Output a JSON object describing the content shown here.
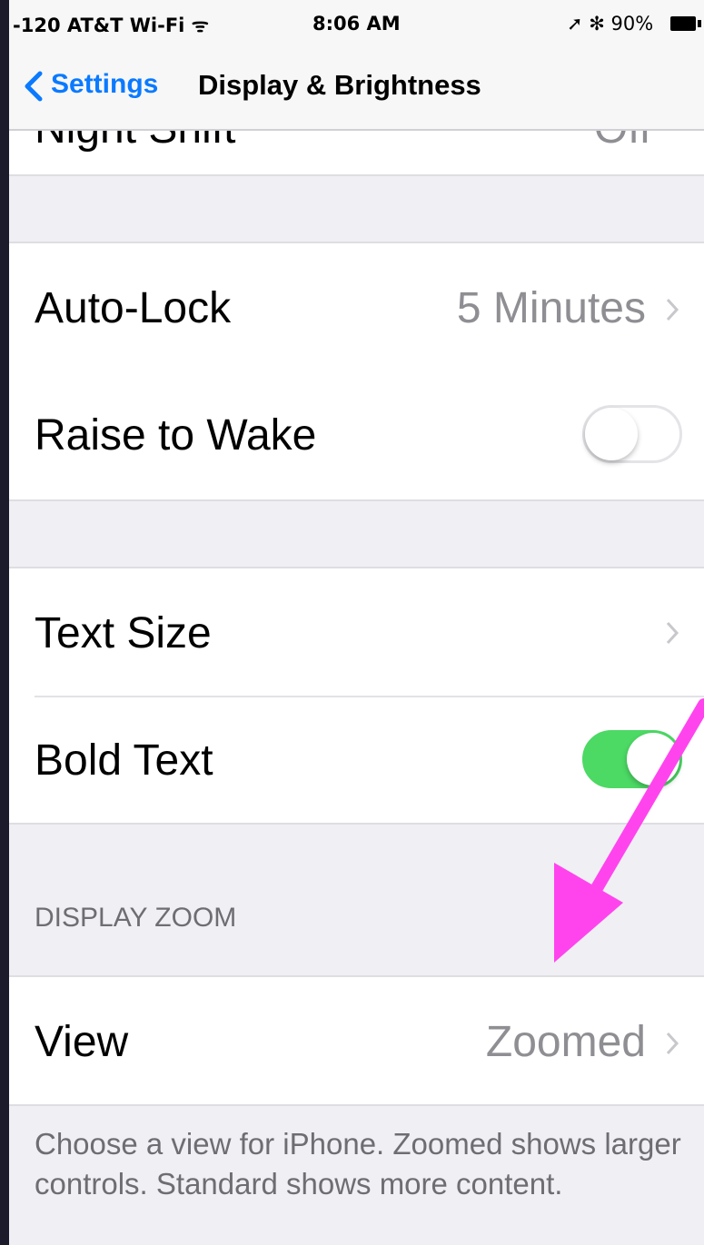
{
  "status_bar": {
    "carrier": "-120 AT&T Wi-Fi ᯤ",
    "time": "8:06 AM",
    "right": "➚ ✻ 90%"
  },
  "nav": {
    "back_label": "Settings",
    "title": "Display & Brightness"
  },
  "top_row": {
    "label": "Night Shift",
    "value": "Off"
  },
  "group_lock": {
    "auto_lock_label": "Auto-Lock",
    "auto_lock_value": "5 Minutes",
    "raise_to_wake_label": "Raise to Wake",
    "raise_to_wake_on": false
  },
  "group_text": {
    "text_size_label": "Text Size",
    "bold_text_label": "Bold Text",
    "bold_text_on": true
  },
  "display_zoom": {
    "header": "DISPLAY ZOOM",
    "view_label": "View",
    "view_value": "Zoomed",
    "footer": "Choose a view for iPhone. Zoomed shows larger controls. Standard shows more content."
  },
  "colors": {
    "accent": "#0a7aff",
    "toggle_on": "#4cd964",
    "annotation_arrow": "#ff44ee"
  }
}
